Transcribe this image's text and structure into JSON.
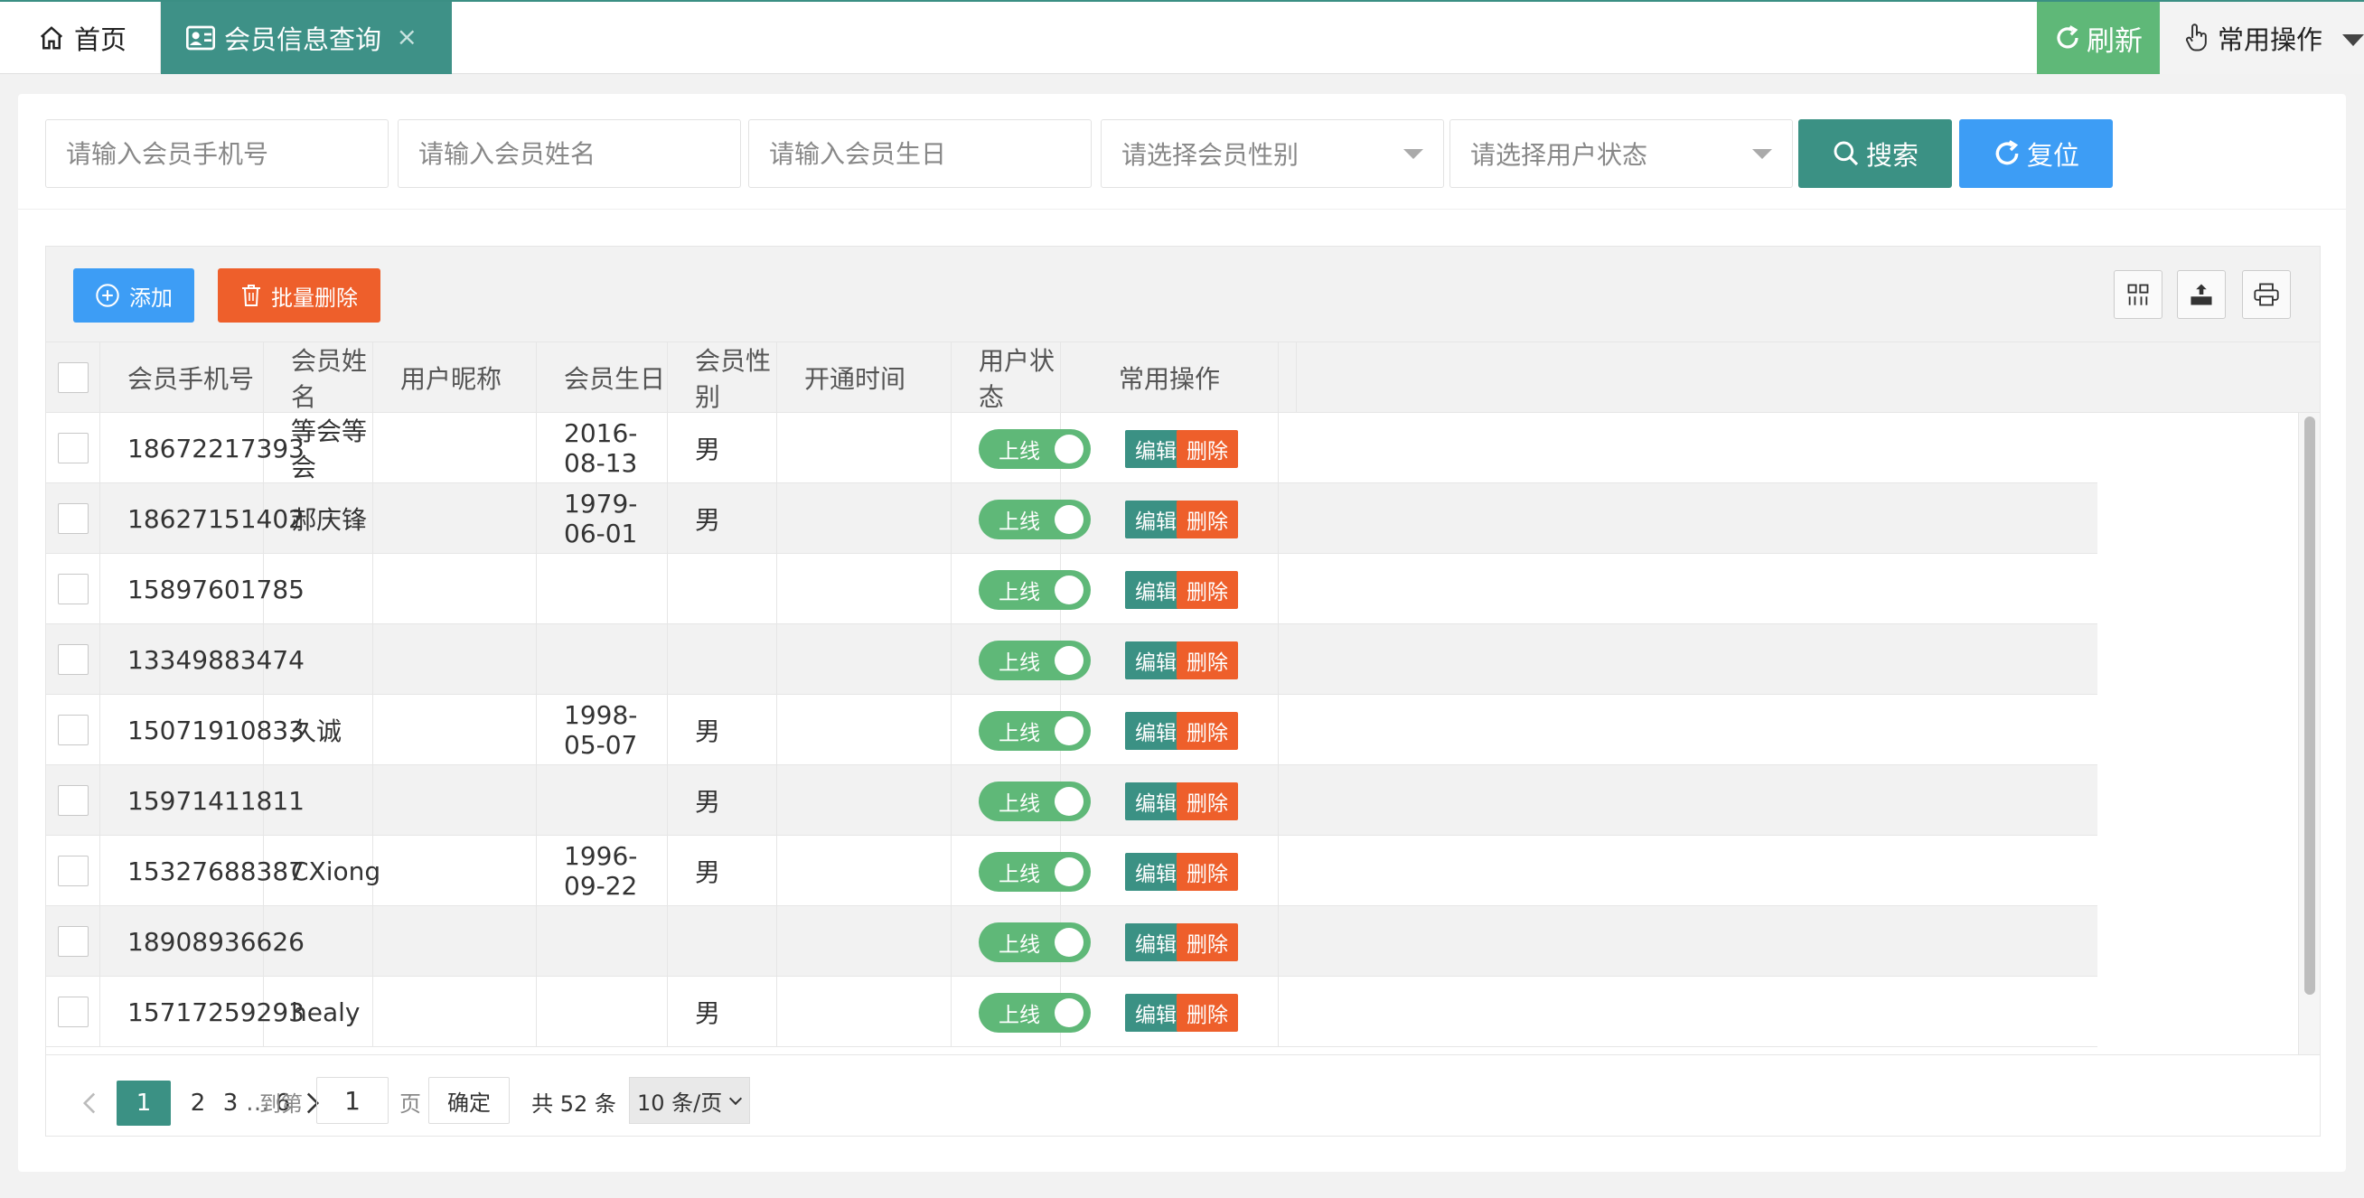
{
  "tabs": {
    "home_label": "首页",
    "member_label": "会员信息查询",
    "close_symbol": "×"
  },
  "top_actions": {
    "refresh_label": "刷新",
    "common_ops_label": "常用操作"
  },
  "search": {
    "phone_placeholder": "请输入会员手机号",
    "name_placeholder": "请输入会员姓名",
    "birthday_placeholder": "请输入会员生日",
    "gender_placeholder": "请选择会员性别",
    "status_placeholder": "请选择用户状态",
    "search_label": "搜索",
    "reset_label": "复位"
  },
  "toolbar": {
    "add_label": "添加",
    "batch_delete_label": "批量删除"
  },
  "table": {
    "columns": [
      "会员手机号",
      "会员姓名",
      "用户昵称",
      "会员生日",
      "会员性别",
      "开通时间",
      "用户状态",
      "常用操作"
    ],
    "switch_label": "上线",
    "edit_label": "编辑",
    "delete_label": "删除",
    "rows": [
      {
        "phone": "18672217393",
        "name": "等会等会",
        "nickname": "",
        "birthday": "2016-08-13",
        "gender": "男",
        "opened": "",
        "status_on": true
      },
      {
        "phone": "18627151402",
        "name": "郝庆锋",
        "nickname": "",
        "birthday": "1979-06-01",
        "gender": "男",
        "opened": "",
        "status_on": true
      },
      {
        "phone": "15897601785",
        "name": "",
        "nickname": "",
        "birthday": "",
        "gender": "",
        "opened": "",
        "status_on": true
      },
      {
        "phone": "13349883474",
        "name": "",
        "nickname": "",
        "birthday": "",
        "gender": "",
        "opened": "",
        "status_on": true
      },
      {
        "phone": "15071910833",
        "name": "久诚",
        "nickname": "",
        "birthday": "1998-05-07",
        "gender": "男",
        "opened": "",
        "status_on": true
      },
      {
        "phone": "15971411811",
        "name": "",
        "nickname": "",
        "birthday": "",
        "gender": "男",
        "opened": "",
        "status_on": true
      },
      {
        "phone": "15327688387",
        "name": "CXiong",
        "nickname": "",
        "birthday": "1996-09-22",
        "gender": "男",
        "opened": "",
        "status_on": true
      },
      {
        "phone": "18908936626",
        "name": "",
        "nickname": "",
        "birthday": "",
        "gender": "",
        "opened": "",
        "status_on": true
      },
      {
        "phone": "15717259293",
        "name": "healy",
        "nickname": "",
        "birthday": "",
        "gender": "男",
        "opened": "",
        "status_on": true
      }
    ]
  },
  "pagination": {
    "pages": [
      "1",
      "2",
      "3"
    ],
    "ellipsis": "…",
    "last_page": "6",
    "goto_label": "到第",
    "goto_value": "1",
    "page_unit": "页",
    "confirm_label": "确定",
    "total_label": "共 52 条",
    "page_size_label": "10 条/页"
  },
  "colors": {
    "primary_teal": "#3b9184",
    "refresh_green": "#5fb878",
    "blue": "#3d9df5",
    "orange": "#ee5f2b"
  }
}
